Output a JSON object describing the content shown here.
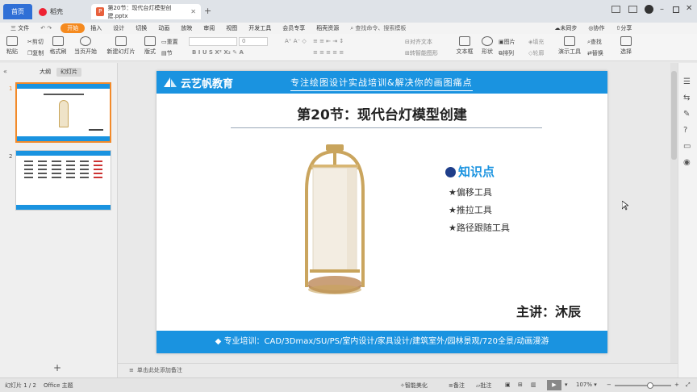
{
  "tabs": {
    "home": "首页",
    "daoke": "稻壳",
    "doc": "第20节：现代台灯模型创建.pptx"
  },
  "menu": {
    "file": "三 文件",
    "items": [
      "开始",
      "插入",
      "设计",
      "切换",
      "动画",
      "放映",
      "审阅",
      "视图",
      "开发工具",
      "会员专享",
      "稻壳资源"
    ],
    "search": "查找命令、搜索模板",
    "sync": "未同步",
    "collab": "协作",
    "share": "分享"
  },
  "ribbon": {
    "paste": "粘贴",
    "cut": "剪切",
    "copy": "复制",
    "format_painter": "格式刷",
    "play_current": "当页开始",
    "new_slide": "新建幻灯片",
    "layout": "版式",
    "section": "节",
    "reset": "重置",
    "font_size": "0",
    "align_text": "对齐文本",
    "smartart": "转智能图形",
    "textbox": "文本框",
    "shape": "形状",
    "picture": "图片",
    "fill": "填充",
    "arrange": "排列",
    "outline": "轮廓",
    "presenter": "演示工具",
    "find": "查找",
    "replace": "替换",
    "select": "选择"
  },
  "left_panel": {
    "outline_tab": "大纲",
    "slides_tab": "幻灯片",
    "slide_numbers": [
      "1",
      "2"
    ],
    "add": "+"
  },
  "slide": {
    "brand": "云艺帆教育",
    "tagline": "专注绘图设计实战培训&解决你的画图痛点",
    "title": "第20节：现代台灯模型创建",
    "kp_title": "知识点",
    "kp_items": [
      "★偏移工具",
      "★推拉工具",
      "★路径跟随工具"
    ],
    "lecturer": "主讲：沐辰",
    "footer": "◆ 专业培训：CAD/3Dmax/SU/PS/室内设计/家具设计/建筑室外/园林景观/720全景/动画漫游"
  },
  "notes": "单击此处添加备注",
  "status": {
    "slide_count": "幻灯片 1 / 2",
    "theme": "Office 主题",
    "smart_beautify": "智能美化",
    "notes": "备注",
    "comment": "批注",
    "zoom": "107%"
  },
  "colors": {
    "accent_blue": "#1a93e0",
    "menu_active": "#f58a1f"
  }
}
